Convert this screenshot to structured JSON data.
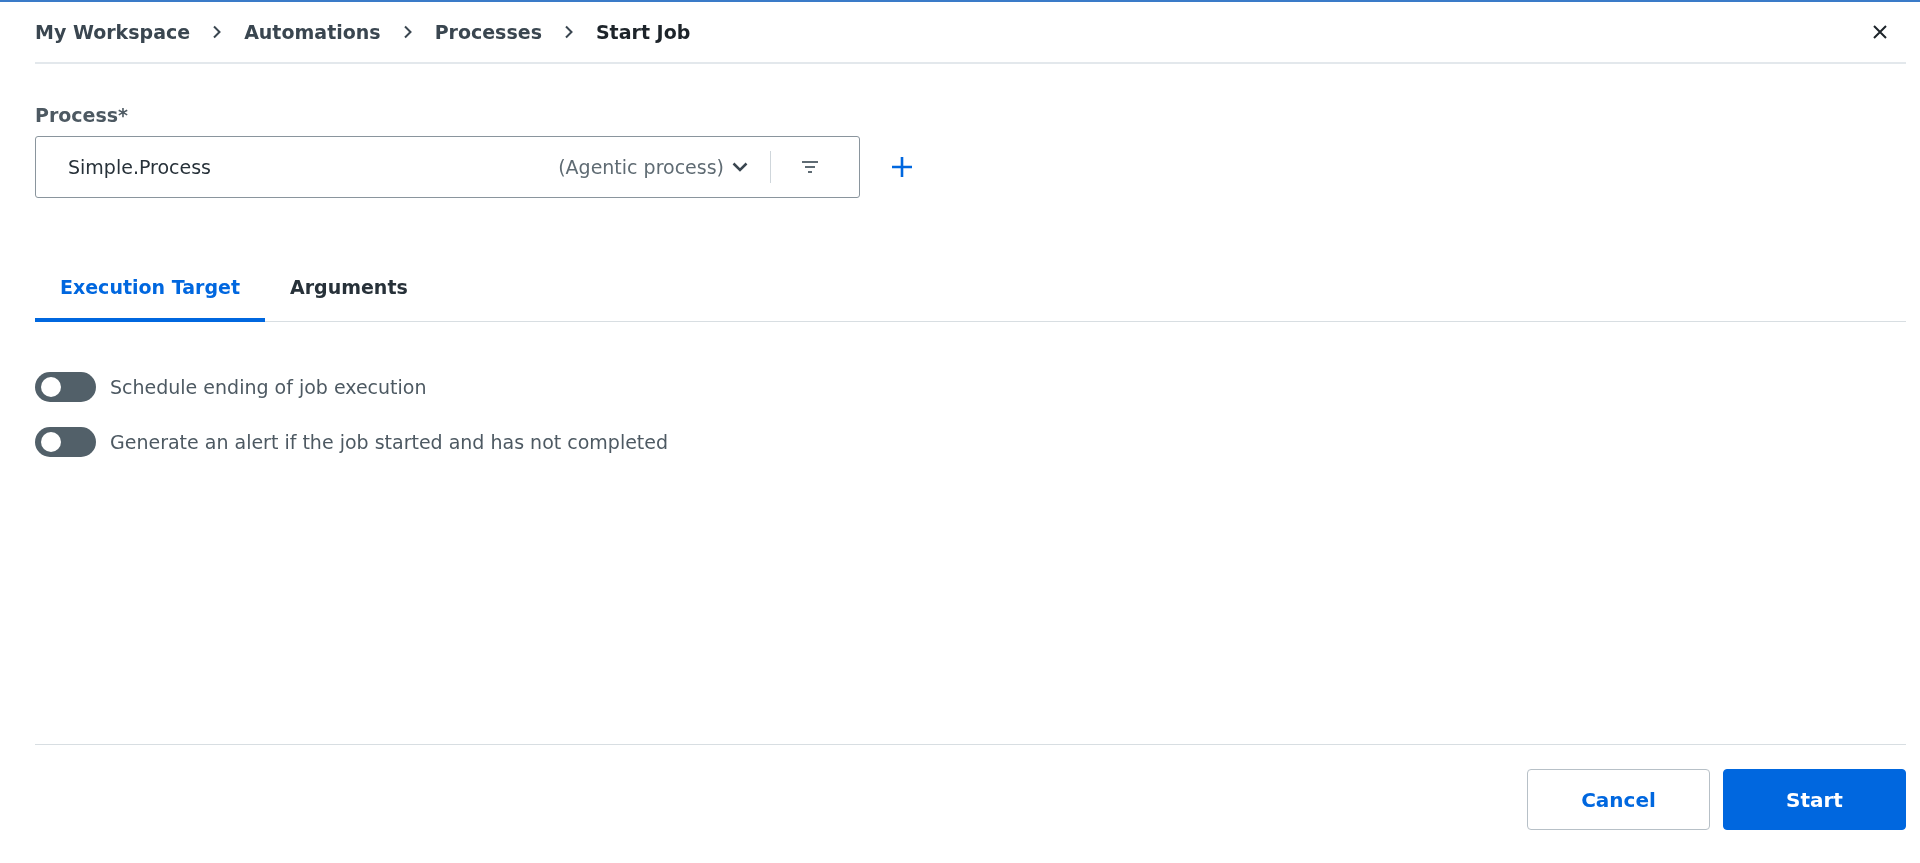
{
  "breadcrumb": [
    {
      "label": "My Workspace",
      "current": false
    },
    {
      "label": "Automations",
      "current": false
    },
    {
      "label": "Processes",
      "current": false
    },
    {
      "label": "Start Job",
      "current": true
    }
  ],
  "process_field": {
    "label": "Process*",
    "value": "Simple.Process",
    "type_label": "(Agentic process)"
  },
  "tabs": [
    {
      "label": "Execution Target",
      "selected": true
    },
    {
      "label": "Arguments",
      "selected": false
    }
  ],
  "toggles": [
    {
      "label": "Schedule ending of job execution",
      "on": false
    },
    {
      "label": "Generate an alert if the job started and has not completed",
      "on": false
    }
  ],
  "buttons": [
    {
      "label": "Cancel",
      "kind": "secondary"
    },
    {
      "label": "Start",
      "kind": "primary"
    }
  ]
}
